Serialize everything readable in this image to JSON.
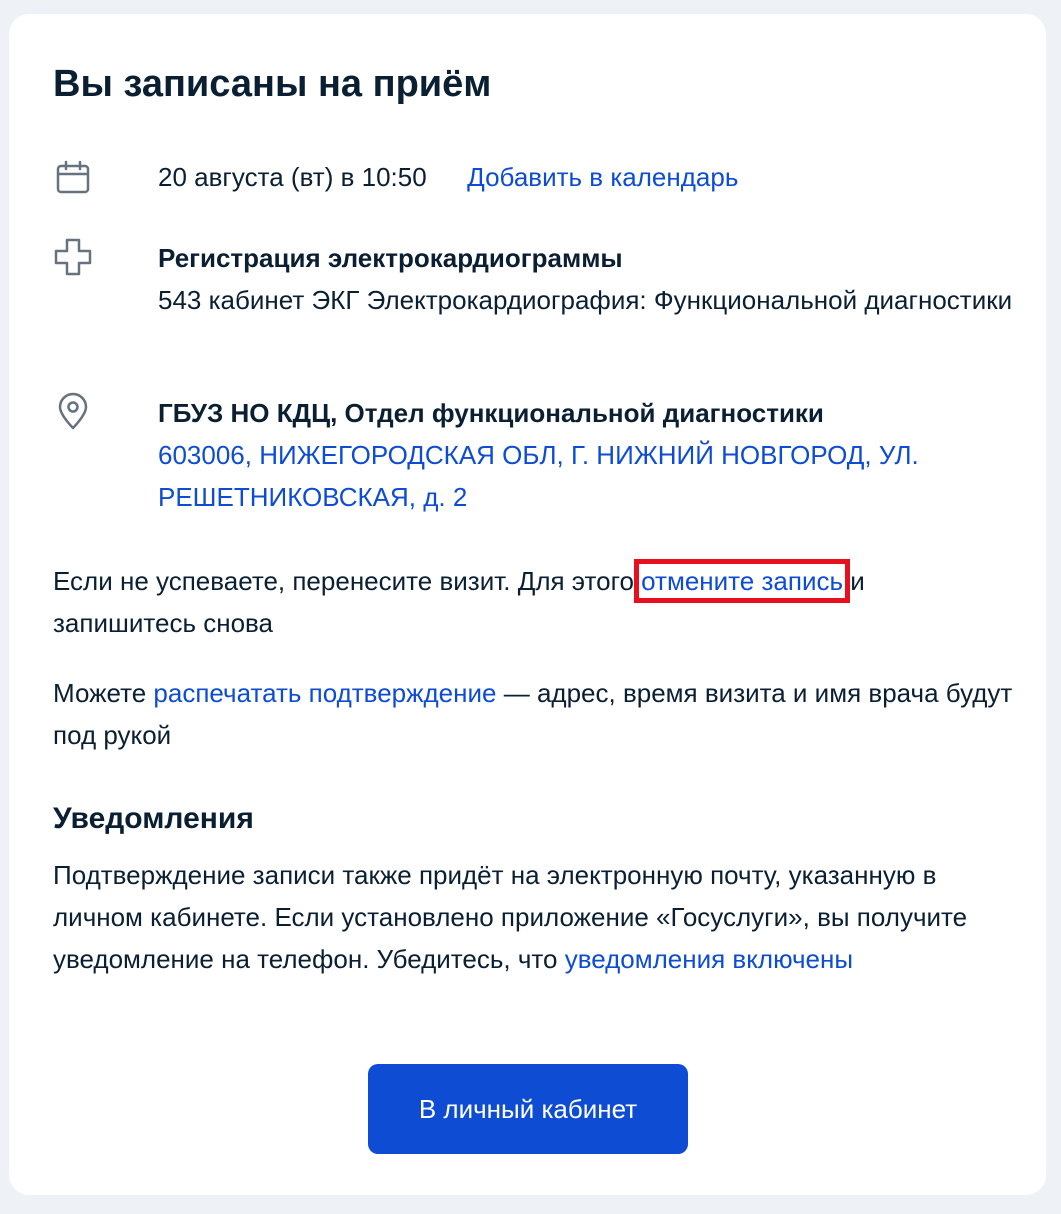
{
  "page": {
    "title": "Вы записаны на приём"
  },
  "appointment": {
    "datetime": "20 августа (вт) в 10:50",
    "add_calendar_link": "Добавить в календарь",
    "service_name": "Регистрация электрокардиограммы",
    "service_details": "543 кабинет ЭКГ Электрокардиография: Функциональной диагностики",
    "clinic_name": "ГБУЗ НО КДЦ, Отдел функциональной диагностики",
    "clinic_address": "603006, НИЖЕГОРОДСКАЯ ОБЛ, Г. НИЖНИЙ НОВГОРОД, УЛ. РЕШЕТНИКОВСКАЯ, д. 2"
  },
  "reschedule": {
    "text_before": "Если не успеваете, перенесите визит. Для этого ",
    "cancel_link": "отмените запись",
    "text_after": " и запишитесь снова"
  },
  "print": {
    "text_before": "Можете ",
    "print_link": "распечатать подтверждение",
    "text_after": " — адрес, время визита и имя врача будут под рукой"
  },
  "notifications": {
    "heading": "Уведомления",
    "text": "Подтверждение записи также придёт на электронную почту, указанную в личном кабинете. Если установлено приложение «Госуслуги», вы получите уведомление на телефон. Убедитесь, что ",
    "link": "уведомления включены"
  },
  "actions": {
    "cabinet_button": "В личный кабинет"
  },
  "colors": {
    "link": "#0d4cd3",
    "button_bg": "#0d4cd3",
    "highlight": "#e8101e",
    "text": "#0b1f33",
    "icon": "#66727f"
  }
}
